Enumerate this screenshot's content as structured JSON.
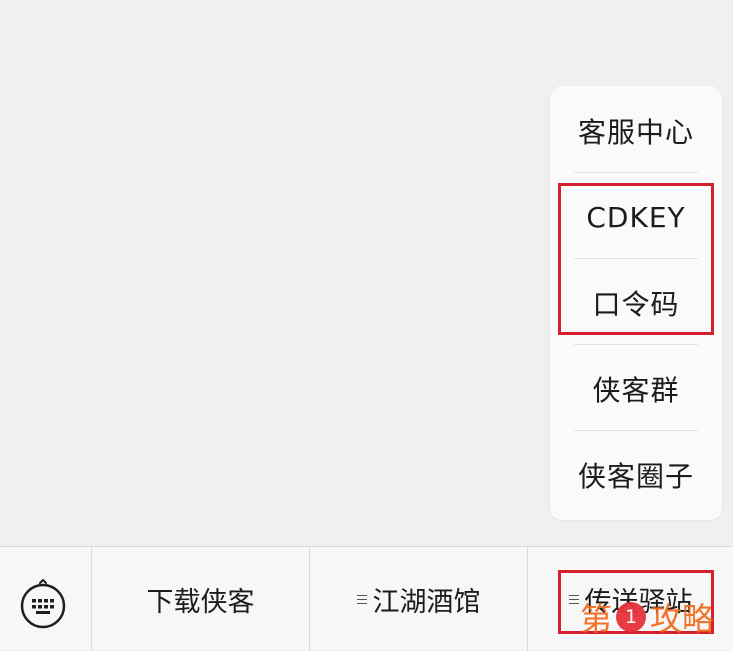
{
  "popup_menu": {
    "items": [
      {
        "label": "客服中心"
      },
      {
        "label": "CDKEY"
      },
      {
        "label": "口令码"
      },
      {
        "label": "侠客群"
      },
      {
        "label": "侠客圈子"
      }
    ]
  },
  "bottom_bar": {
    "keyboard_icon": "keyboard-icon",
    "tabs": [
      {
        "label": "下载侠客"
      },
      {
        "label": "江湖酒馆"
      },
      {
        "label": "传送驿站"
      }
    ]
  },
  "watermark": {
    "text_left": "第",
    "badge": "1",
    "text_right": "攻略"
  },
  "colors": {
    "highlight": "#d4202c",
    "watermark": "#f26b1d",
    "badge": "#e8323c"
  }
}
